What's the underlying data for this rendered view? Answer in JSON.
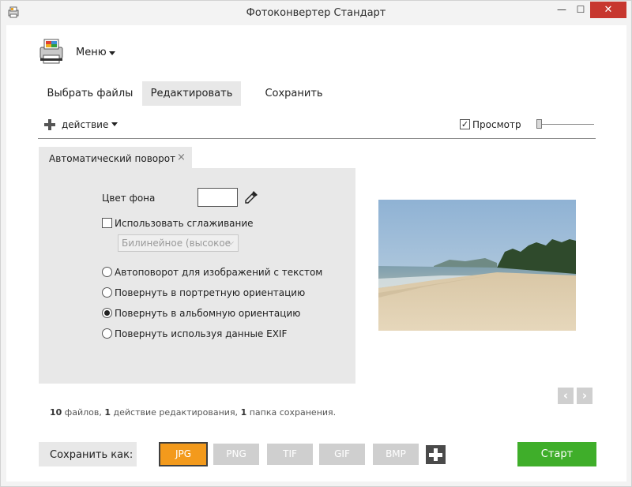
{
  "window": {
    "title": "Фотоконвертер Стандарт",
    "minimize_glyph": "—",
    "maximize_glyph": "☐",
    "close_glyph": "✕"
  },
  "menu": {
    "label": "Меню"
  },
  "tabs": [
    {
      "label": "Выбрать файлы",
      "active": false
    },
    {
      "label": "Редактировать",
      "active": true
    },
    {
      "label": "Сохранить",
      "active": false
    }
  ],
  "toolbar": {
    "action_label": "действие",
    "preview_label": "Просмотр",
    "preview_checked": true,
    "preview_check_glyph": "✓"
  },
  "action_panel": {
    "tab_label": "Автоматический поворот",
    "tab_close_glyph": "×",
    "bg_color_label": "Цвет фона",
    "bg_color_value": "#ffffff",
    "smoothing_label": "Использовать сглаживание",
    "smoothing_checked": false,
    "interpolation_value": "Билинейное (высокое",
    "options": [
      {
        "label": "Автоповорот для изображений с текстом",
        "checked": false
      },
      {
        "label": "Повернуть в портретную ориентацию",
        "checked": false
      },
      {
        "label": "Повернуть в альбомную ориентацию",
        "checked": true
      },
      {
        "label": "Повернуть используя данные EXIF",
        "checked": false
      }
    ]
  },
  "navigation": {
    "prev_glyph": "‹",
    "next_glyph": "›"
  },
  "summary": {
    "files_count": "10",
    "files_text": " файлов, ",
    "actions_count": "1",
    "actions_text": " действие редактирования, ",
    "folders_count": "1",
    "folders_text": " папка сохранения."
  },
  "save": {
    "save_as_label": "Сохранить как:",
    "formats": [
      {
        "label": "JPG",
        "selected": true
      },
      {
        "label": "PNG",
        "selected": false
      },
      {
        "label": "TIF",
        "selected": false
      },
      {
        "label": "GIF",
        "selected": false
      },
      {
        "label": "BMP",
        "selected": false
      }
    ],
    "start_label": "Старт"
  },
  "colors": {
    "accent_orange": "#f39a1c",
    "start_green": "#3fae2a",
    "close_red": "#c7372f",
    "panel_gray": "#e8e8e8"
  },
  "icons": {
    "app_icon": "printer-photo-icon",
    "add_action_icon": "plus-icon",
    "eyedropper": "eyedropper-icon",
    "add_format": "plus-icon"
  }
}
